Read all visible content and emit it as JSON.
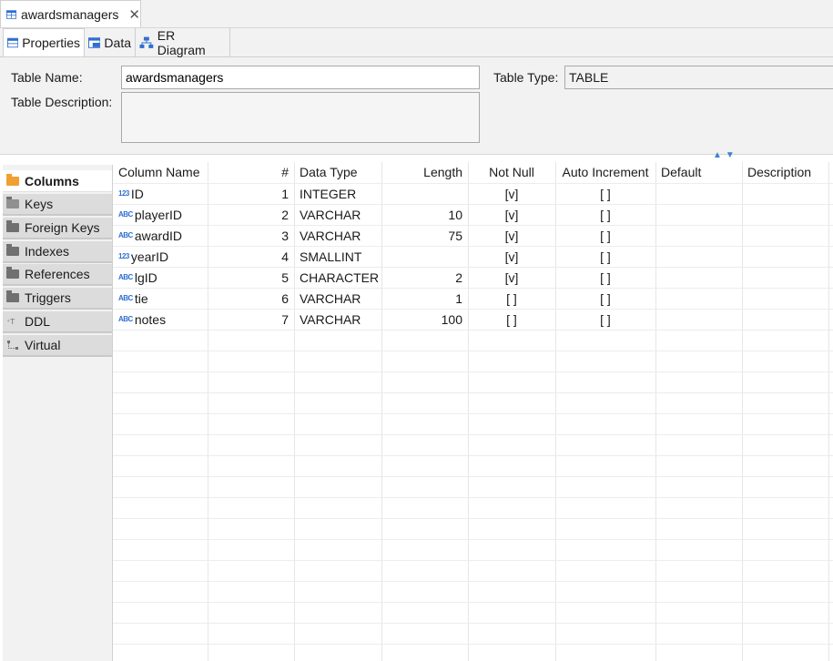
{
  "editor_tab": {
    "title": "awardsmanagers",
    "close_symbol": "✕"
  },
  "subtabs": [
    {
      "label": "Properties"
    },
    {
      "label": "Data"
    },
    {
      "label": "ER Diagram"
    }
  ],
  "properties": {
    "table_name_label": "Table Name:",
    "table_name_value": "awardsmanagers",
    "table_type_label": "Table Type:",
    "table_type_value": "TABLE",
    "table_description_label": "Table Description:",
    "table_description_value": ""
  },
  "side_tabs": [
    {
      "label": "Columns",
      "active": true
    },
    {
      "label": "Keys"
    },
    {
      "label": "Foreign Keys"
    },
    {
      "label": "Indexes"
    },
    {
      "label": "References"
    },
    {
      "label": "Triggers"
    },
    {
      "label": "DDL"
    },
    {
      "label": "Virtual"
    }
  ],
  "grid": {
    "headers": [
      "Column Name",
      "#",
      "Data Type",
      "Length",
      "Not Null",
      "Auto Increment",
      "Default",
      "Description"
    ],
    "rows": [
      {
        "icon": "123",
        "name": "ID",
        "num": "1",
        "type": "INTEGER",
        "length": "",
        "not_null": "[v]",
        "auto_inc": "[ ]"
      },
      {
        "icon": "ABC",
        "name": "playerID",
        "num": "2",
        "type": "VARCHAR",
        "length": "10",
        "not_null": "[v]",
        "auto_inc": "[ ]"
      },
      {
        "icon": "ABC",
        "name": "awardID",
        "num": "3",
        "type": "VARCHAR",
        "length": "75",
        "not_null": "[v]",
        "auto_inc": "[ ]"
      },
      {
        "icon": "123",
        "name": "yearID",
        "num": "4",
        "type": "SMALLINT",
        "length": "",
        "not_null": "[v]",
        "auto_inc": "[ ]"
      },
      {
        "icon": "ABC",
        "name": "lgID",
        "num": "5",
        "type": "CHARACTER",
        "length": "2",
        "not_null": "[v]",
        "auto_inc": "[ ]"
      },
      {
        "icon": "ABC",
        "name": "tie",
        "num": "6",
        "type": "VARCHAR",
        "length": "1",
        "not_null": "[ ]",
        "auto_inc": "[ ]"
      },
      {
        "icon": "ABC",
        "name": "notes",
        "num": "7",
        "type": "VARCHAR",
        "length": "100",
        "not_null": "[ ]",
        "auto_inc": "[ ]"
      }
    ]
  },
  "colors": {
    "accent": "#2f6fd0",
    "columns_icon": "#f0a030"
  }
}
